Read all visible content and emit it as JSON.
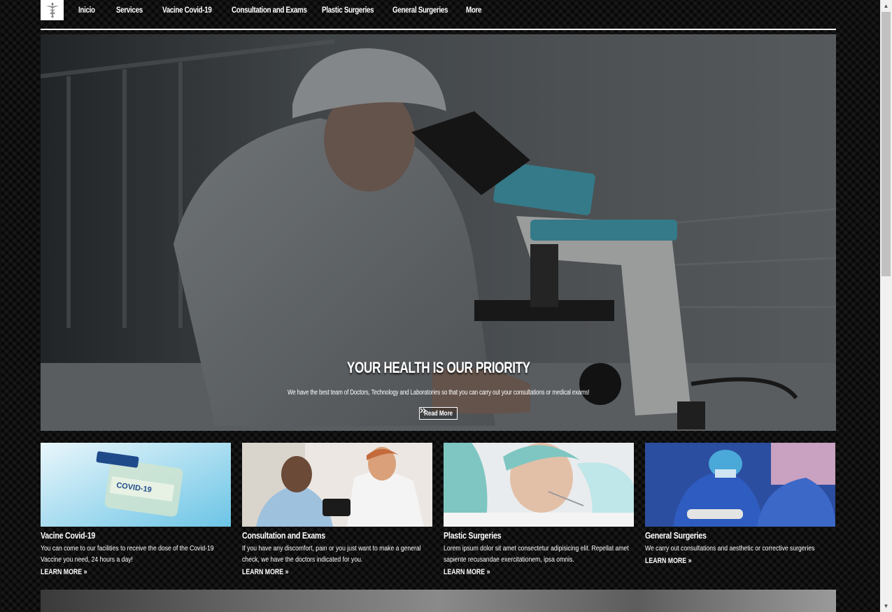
{
  "nav": {
    "logo_icon": "caduceus-icon",
    "links": [
      "Inicio",
      "Services",
      "Vacine Covid-19",
      "Consultation and Exams",
      "Plastic Surgeries",
      "General Surgeries",
      "More"
    ]
  },
  "hero": {
    "title": "YOUR HEALTH IS OUR PRIORITY",
    "subtitle": "We have the best team of Doctors, Technology and Laboratories so that you can carry out your consultations or medical exams!",
    "button_label": "Read More",
    "button_icon": "double-chevron-right-icon"
  },
  "cards": [
    {
      "title": "Vacine Covid-19",
      "text": "You can come to our facilities to receive the dose of the Covid-19 Vaccine you need, 24 hours a day!",
      "link": "LEARN MORE",
      "vial_label": "COVID-19"
    },
    {
      "title": "Consultation and Exams",
      "text": "If you have any discomfort, pain or you just want to make a general check, we have the doctors indicated for you.",
      "link": "LEARN MORE"
    },
    {
      "title": "Plastic Surgeries",
      "text": "Lorem ipsum dolor sit amet consectetur adipisicing elit. Repellat amet sapiente recusandae exercitationem, ipsa omnis.",
      "link": "LEARN MORE"
    },
    {
      "title": "General Surgeries",
      "text": "We carry out consultations and aesthetic or corrective surgeries",
      "link": "LEARN MORE"
    }
  ],
  "colors": {
    "background": "#111111",
    "text": "#ffffff",
    "accent_teal": "#4aa9bd"
  }
}
